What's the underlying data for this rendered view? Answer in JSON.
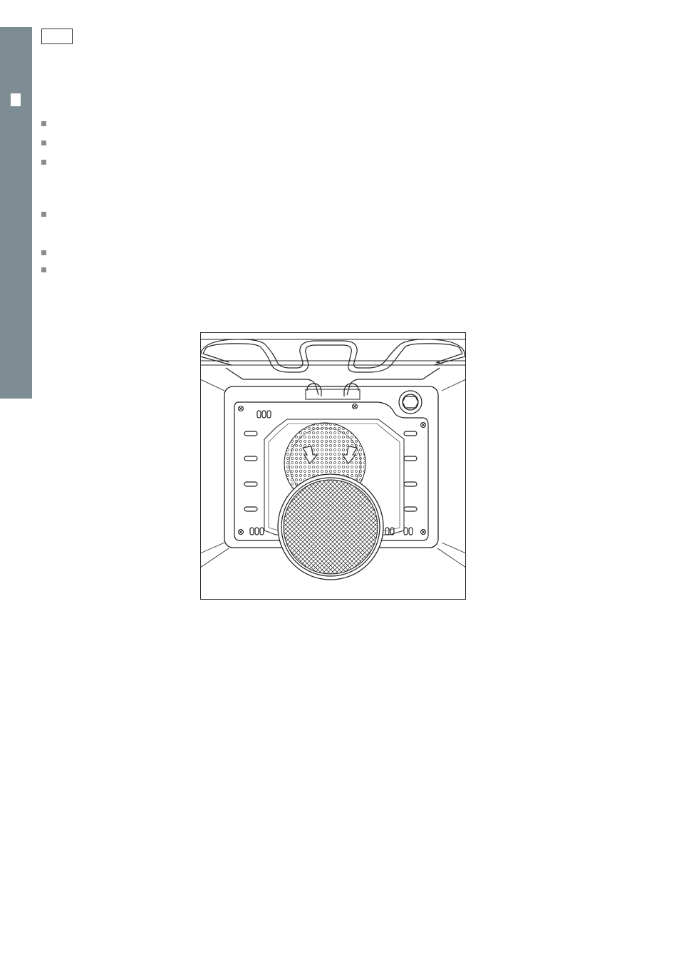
{
  "document": {
    "side_tab": {
      "color": "#7e8d94"
    },
    "bullet_color": "#8c8c8c",
    "bullets": [
      {
        "id": "bullet-1"
      },
      {
        "id": "bullet-2"
      },
      {
        "id": "bullet-3"
      },
      {
        "id": "bullet-4"
      },
      {
        "id": "bullet-5"
      },
      {
        "id": "bullet-6"
      }
    ],
    "figure": {
      "subject": "oven-interior-illustration",
      "icons": [
        "heating-element-icon",
        "fan-cover-icon",
        "lamp-icon",
        "airflow-arrow-icon",
        "shelf-runner-icon",
        "screw-icon"
      ]
    }
  }
}
